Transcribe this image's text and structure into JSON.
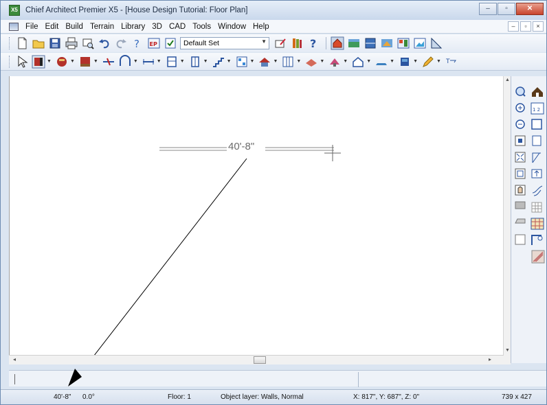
{
  "window": {
    "title": "Chief Architect Premier X5 - [House Design Tutorial: Floor Plan]",
    "app_icon_text": "X5",
    "buttons": {
      "minimize": "–",
      "maximize": "▫",
      "close": "✕"
    }
  },
  "menubar": {
    "items": [
      "File",
      "Edit",
      "Build",
      "Terrain",
      "Library",
      "3D",
      "CAD",
      "Tools",
      "Window",
      "Help"
    ],
    "mdi_buttons": [
      "–",
      "▫",
      "×"
    ]
  },
  "toolbar1": {
    "set_combo_value": "Default Set"
  },
  "canvas": {
    "dimension_label": "40'-8\""
  },
  "statusbar": {
    "length": "40'-8\"",
    "angle": "0.0°",
    "floor": "Floor: 1",
    "layer": "Object layer: Walls,  Normal",
    "coords": "X: 817\", Y: 687\", Z: 0\"",
    "size": "739 x 427"
  },
  "colors": {
    "titlebar": "#c9d8ec",
    "close_button": "#c8442d",
    "canvas": "#ffffff"
  }
}
